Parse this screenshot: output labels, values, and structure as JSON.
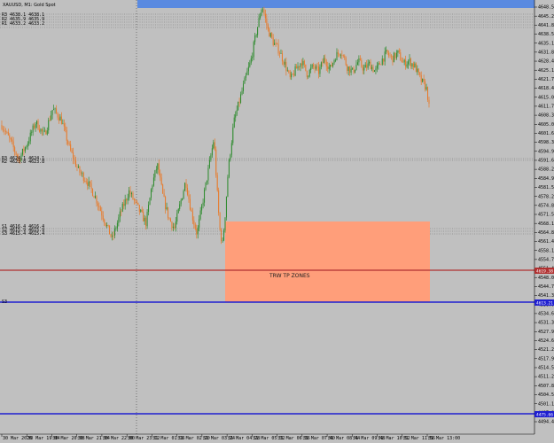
{
  "window": {
    "title": "XAUUSD, M1: Gold Spot"
  },
  "colors": {
    "background": "#c0c0c0",
    "bull_candle": "#2e8b2e",
    "bear_candle": "#e87a2a",
    "zone_fill": "#ff9e7a",
    "support_line": "#1f1fd0",
    "red_line": "#b03030",
    "top_band": "#5a8ae0",
    "grid_dotted": "#707070"
  },
  "zone": {
    "label": "TRW TP ZONES"
  },
  "price_tags": {
    "red": "4619.38",
    "blue": "4613.21",
    "bottom": "4475.66"
  },
  "left_labels": {
    "top_group": [
      "R3 4638.1 4638.1",
      "R2 4635.9 4635.9",
      "R1 4633.2 4633.2"
    ],
    "mid_group": [
      "R3 4624.1 4624.1",
      "R2 4623.8 4623.8"
    ],
    "lower_group": [
      "S1 4616.4 4616.4",
      "S2 4615.9 4615.9",
      "S3 4615.4 4615.4"
    ],
    "blue_tag": "S3"
  },
  "chart_data": {
    "type": "candlestick",
    "title": "XAUUSD, M1: Gold Spot",
    "y_axis": {
      "ylim": [
        4492,
        4650
      ],
      "ticks": [
        4648.55,
        4645.2,
        4641.85,
        4638.5,
        4635.15,
        4631.8,
        4628.45,
        4625.1,
        4621.75,
        4618.4,
        4615.05,
        4611.7,
        4608.35,
        4605.0,
        4601.65,
        4598.3,
        4594.95,
        4591.6,
        4588.25,
        4584.9,
        4581.55,
        4578.2,
        4574.85,
        4571.5,
        4568.15,
        4564.8,
        4561.45,
        4558.1,
        4554.75,
        4551.4,
        4548.05,
        4544.7,
        4541.35,
        4538.0,
        4534.65,
        4531.3,
        4527.95,
        4524.6,
        4521.25,
        4517.9,
        4514.55,
        4511.2,
        4507.85,
        4504.5,
        4501.15,
        4497.8,
        4494.45
      ]
    },
    "x_axis": {
      "ticks": [
        "30 Mar 2026",
        "30 Mar 19:04",
        "30 Mar 20:08",
        "30 Mar 21:04",
        "30 Mar 22:00",
        "30 Mar 23:12",
        "31 Mar 01:16",
        "31 Mar 02:20",
        "31 Mar 03:24",
        "31 Mar 04:28",
        "31 Mar 05:32",
        "31 Mar 06:36",
        "31 Mar 07:40",
        "31 Mar 08:44",
        "31 Mar 09:48",
        "31 Mar 10:52",
        "31 Mar 11:56",
        "31 Mar 13:00"
      ]
    },
    "levels": {
      "red": 4619.38,
      "blue": 4613.21,
      "bottom": 4475.66,
      "dotted": [
        4646.2,
        4645.8,
        4645.1,
        4644.0,
        4643.4,
        4642.8,
        4623.9,
        4623.5,
        4616.3,
        4615.8,
        4615.3
      ]
    },
    "zone": {
      "start_index": 176,
      "end_index": 330,
      "top": 4625.0,
      "bottom": 4613.3
    },
    "path": [
      [
        0,
        4605
      ],
      [
        6,
        4599
      ],
      [
        12,
        4592
      ],
      [
        18,
        4598
      ],
      [
        24,
        4606
      ],
      [
        30,
        4601
      ],
      [
        36,
        4611
      ],
      [
        42,
        4607
      ],
      [
        48,
        4596
      ],
      [
        54,
        4588
      ],
      [
        60,
        4584
      ],
      [
        66,
        4578
      ],
      [
        72,
        4570
      ],
      [
        78,
        4562
      ],
      [
        84,
        4572
      ],
      [
        90,
        4580
      ],
      [
        96,
        4574
      ],
      [
        102,
        4568
      ],
      [
        106,
        4582
      ],
      [
        110,
        4590
      ],
      [
        114,
        4578
      ],
      [
        118,
        4570
      ],
      [
        122,
        4566
      ],
      [
        126,
        4575
      ],
      [
        130,
        4584
      ],
      [
        134,
        4572
      ],
      [
        138,
        4564
      ],
      [
        142,
        4576
      ],
      [
        146,
        4588
      ],
      [
        150,
        4600
      ],
      [
        152,
        4582
      ],
      [
        154,
        4566
      ],
      [
        156,
        4560
      ],
      [
        158,
        4572
      ],
      [
        160,
        4588
      ],
      [
        164,
        4606
      ],
      [
        168,
        4614
      ],
      [
        172,
        4622
      ],
      [
        176,
        4629
      ],
      [
        180,
        4640
      ],
      [
        184,
        4650
      ],
      [
        188,
        4641
      ],
      [
        192,
        4636
      ],
      [
        196,
        4633
      ],
      [
        200,
        4628
      ],
      [
        204,
        4622
      ],
      [
        208,
        4626
      ],
      [
        212,
        4629
      ],
      [
        216,
        4624
      ],
      [
        220,
        4627
      ],
      [
        224,
        4625
      ],
      [
        228,
        4630
      ],
      [
        232,
        4626
      ],
      [
        236,
        4631
      ],
      [
        240,
        4633
      ],
      [
        244,
        4627
      ],
      [
        248,
        4625
      ],
      [
        252,
        4629
      ],
      [
        256,
        4626
      ],
      [
        260,
        4628
      ],
      [
        264,
        4625
      ],
      [
        268,
        4629
      ],
      [
        272,
        4632
      ],
      [
        276,
        4630
      ],
      [
        280,
        4632
      ],
      [
        284,
        4628
      ],
      [
        288,
        4629
      ],
      [
        292,
        4627
      ],
      [
        296,
        4622
      ],
      [
        300,
        4619
      ],
      [
        302,
        4613
      ]
    ],
    "path_note_units": "price",
    "candle_count": 330
  }
}
